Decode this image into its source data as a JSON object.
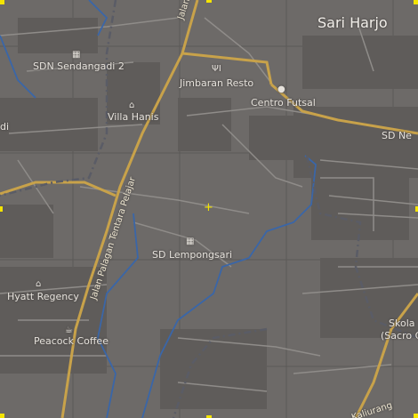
{
  "map": {
    "place_labels": {
      "town": "Sari Harjo",
      "sdn_sendangadi": "SDN Sendangadi 2",
      "villa_hanis": "Villa Hanis",
      "jimbaran_resto": "Jimbaran Resto",
      "centro_futsal": "Centro Futsal",
      "sd_ne": "SD Ne",
      "sd_lempongsari": "SD Lempongsari",
      "hyatt_regency": "Hyatt Regency",
      "peacock_coffee": "Peacock Coffee",
      "skola": "Skola",
      "sacro": "(Sacro C"
    },
    "road_labels": {
      "jalan_pa": "Jalan Pa",
      "jalan_palagan": "Jalan Palagan Tentara Pelajar",
      "kaliurang": "Kaliurang",
      "edge_di": "di"
    },
    "icons": {
      "school": "school-icon",
      "hotel": "hotel-icon",
      "restaurant": "restaurant-icon",
      "sports": "sports-icon",
      "cafe": "cafe-icon",
      "crosshair": "crosshair-icon"
    },
    "colors": {
      "background": "#6d6a68",
      "main_road": "#c8a24a",
      "minor_road": "#8f8c89",
      "river": "#3a66a8",
      "boundary": "#5a5c66",
      "grid": "#5b5957",
      "marker": "#f4e400"
    }
  }
}
